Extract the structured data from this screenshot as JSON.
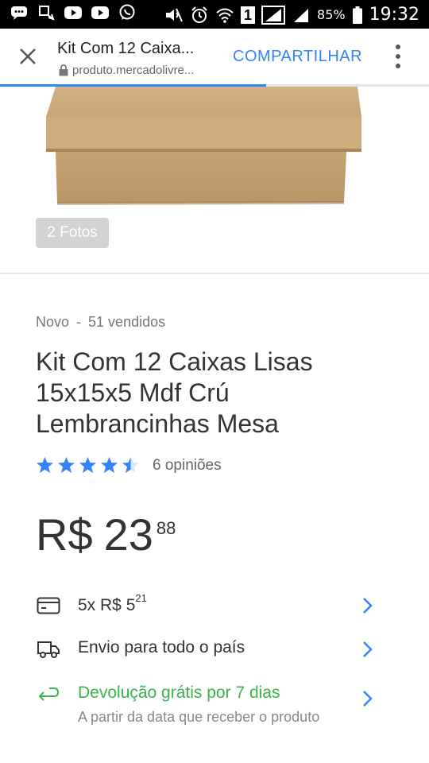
{
  "status_bar": {
    "time": "19:32",
    "battery": "85%",
    "sim": "1",
    "icons": [
      "chat-icon",
      "cast-icon",
      "youtube-icon",
      "youtube-icon",
      "whatsapp-icon",
      "mute-icon",
      "alarm-icon",
      "wifi-icon",
      "signal-icon",
      "battery-icon"
    ]
  },
  "top_bar": {
    "title": "Kit Com 12 Caixa...",
    "url": "produto.mercadolivre...",
    "share_label": "COMPARTILHAR",
    "load_progress": 0.62
  },
  "gallery": {
    "photos_label": "2 Fotos"
  },
  "product": {
    "condition": "Novo",
    "separator": "-",
    "sold": "51 vendidos",
    "title": "Kit Com 12 Caixas Lisas 15x15x5 Mdf Crú Lembrancinhas Mesa",
    "rating": 4.5,
    "reviews": "6 opiniões",
    "price": {
      "currency": "R$",
      "integer": "23",
      "cents": "88"
    },
    "installments": {
      "count_text": "5x R$ 5",
      "cents": "21"
    },
    "shipping": "Envio para todo o país",
    "returns": {
      "title": "Devolução grátis por 7 dias",
      "subtitle": "A partir da data que receber o produto"
    }
  },
  "colors": {
    "accent": "#3483fa",
    "green": "#39b54a",
    "star": "#3483fa",
    "box": "#c9a77a"
  }
}
